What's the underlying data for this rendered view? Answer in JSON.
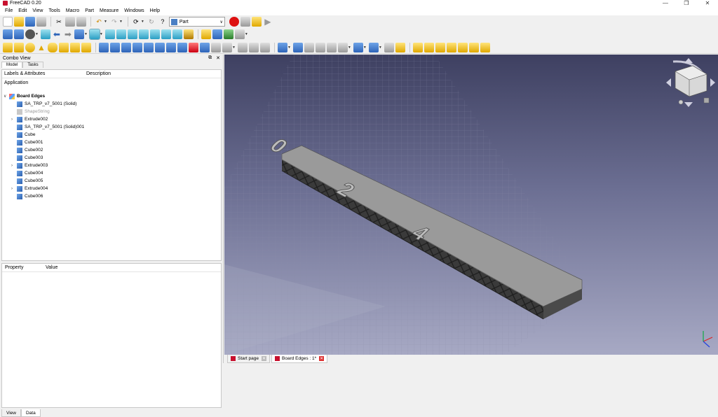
{
  "window": {
    "title": "FreeCAD 0.20",
    "minimize": "—",
    "maximize": "❐",
    "close": "✕"
  },
  "menu": [
    "File",
    "Edit",
    "View",
    "Tools",
    "Macro",
    "Part",
    "Measure",
    "Windows",
    "Help"
  ],
  "workbench": {
    "selected": "Part"
  },
  "combo_view": {
    "title": "Combo View",
    "float_icon": "⧉",
    "close_icon": "✕",
    "tabs": [
      "Model",
      "Tasks"
    ],
    "tree_headers": [
      "Labels & Attributes",
      "Description"
    ],
    "section": "Application",
    "tree": [
      {
        "label": "Board Edges",
        "icon": "document-icon",
        "level": 0,
        "expander": "∨"
      },
      {
        "label": "SA_TRP_v7_5001 (Solid)",
        "icon": "solid-icon",
        "level": 1,
        "expander": ""
      },
      {
        "label": "ShapeString",
        "icon": "shapestring-icon",
        "level": 1,
        "expander": "",
        "disabled": true
      },
      {
        "label": "Extrude002",
        "icon": "extrude-icon",
        "level": 1,
        "expander": "›"
      },
      {
        "label": "SA_TRP_v7_5001 (Solid)001",
        "icon": "solid-icon",
        "level": 1,
        "expander": ""
      },
      {
        "label": "Cube",
        "icon": "solid-icon",
        "level": 1,
        "expander": ""
      },
      {
        "label": "Cube001",
        "icon": "solid-icon",
        "level": 1,
        "expander": ""
      },
      {
        "label": "Cube002",
        "icon": "solid-icon",
        "level": 1,
        "expander": ""
      },
      {
        "label": "Cube003",
        "icon": "solid-icon",
        "level": 1,
        "expander": ""
      },
      {
        "label": "Extrude003",
        "icon": "extrude-icon",
        "level": 1,
        "expander": "›"
      },
      {
        "label": "Cube004",
        "icon": "solid-icon",
        "level": 1,
        "expander": ""
      },
      {
        "label": "Cube005",
        "icon": "solid-icon",
        "level": 1,
        "expander": ""
      },
      {
        "label": "Extrude004",
        "icon": "extrude-icon",
        "level": 1,
        "expander": "›"
      },
      {
        "label": "Cube006",
        "icon": "solid-icon",
        "level": 1,
        "expander": ""
      }
    ],
    "property_headers": [
      "Property",
      "Value"
    ],
    "bottom_tabs": [
      "View",
      "Data"
    ]
  },
  "model_text": [
    "0",
    "2",
    "4"
  ],
  "doc_tabs": [
    {
      "label": "Start page",
      "active": false
    },
    {
      "label": "Board Edges : 1*",
      "active": true
    }
  ],
  "colors": {
    "bg_top": "#3e4061",
    "bg_bottom": "#a7a9c4",
    "model": "#8e8e8e"
  }
}
